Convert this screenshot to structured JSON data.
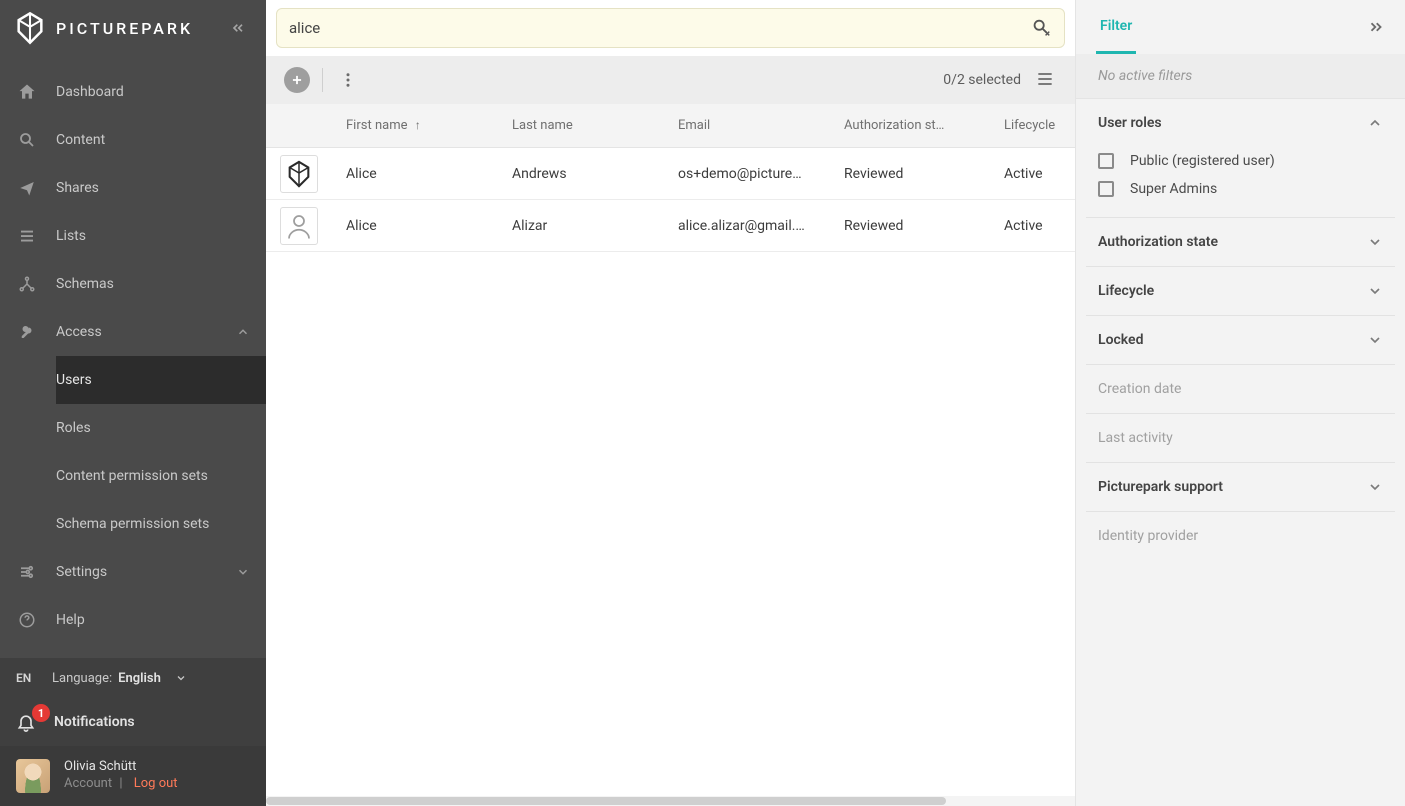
{
  "brand": {
    "name": "PICTUREPARK"
  },
  "sidebar": {
    "items": [
      {
        "label": "Dashboard"
      },
      {
        "label": "Content"
      },
      {
        "label": "Shares"
      },
      {
        "label": "Lists"
      },
      {
        "label": "Schemas"
      },
      {
        "label": "Access"
      },
      {
        "label": "Settings"
      },
      {
        "label": "Help"
      }
    ],
    "access_children": [
      {
        "label": "Users"
      },
      {
        "label": "Roles"
      },
      {
        "label": "Content permission sets"
      },
      {
        "label": "Schema permission sets"
      }
    ],
    "language": {
      "code": "EN",
      "label": "Language:",
      "value": "English"
    },
    "notifications": {
      "label": "Notifications",
      "count": "1"
    },
    "user": {
      "name": "Olivia Schütt",
      "account": "Account",
      "sep": "|",
      "logout": "Log out"
    }
  },
  "search": {
    "value": "alice"
  },
  "toolbar": {
    "selected": "0/2 selected"
  },
  "table": {
    "columns": {
      "first": "First name",
      "last": "Last name",
      "email": "Email",
      "auth": "Authorization st…",
      "life": "Lifecycle"
    },
    "rows": [
      {
        "first": "Alice",
        "last": "Andrews",
        "email": "os+demo@picture…",
        "auth": "Reviewed",
        "life": "Active"
      },
      {
        "first": "Alice",
        "last": "Alizar",
        "email": "alice.alizar@gmail.…",
        "auth": "Reviewed",
        "life": "Active"
      }
    ]
  },
  "filter": {
    "tab": "Filter",
    "empty": "No active filters",
    "sections": {
      "user_roles": {
        "title": "User roles",
        "options": [
          "Public (registered user)",
          "Super Admins"
        ]
      },
      "auth": "Authorization state",
      "lifecycle": "Lifecycle",
      "locked": "Locked",
      "creation": "Creation date",
      "last_activity": "Last activity",
      "pp_support": "Picturepark support",
      "idp": "Identity provider"
    }
  }
}
